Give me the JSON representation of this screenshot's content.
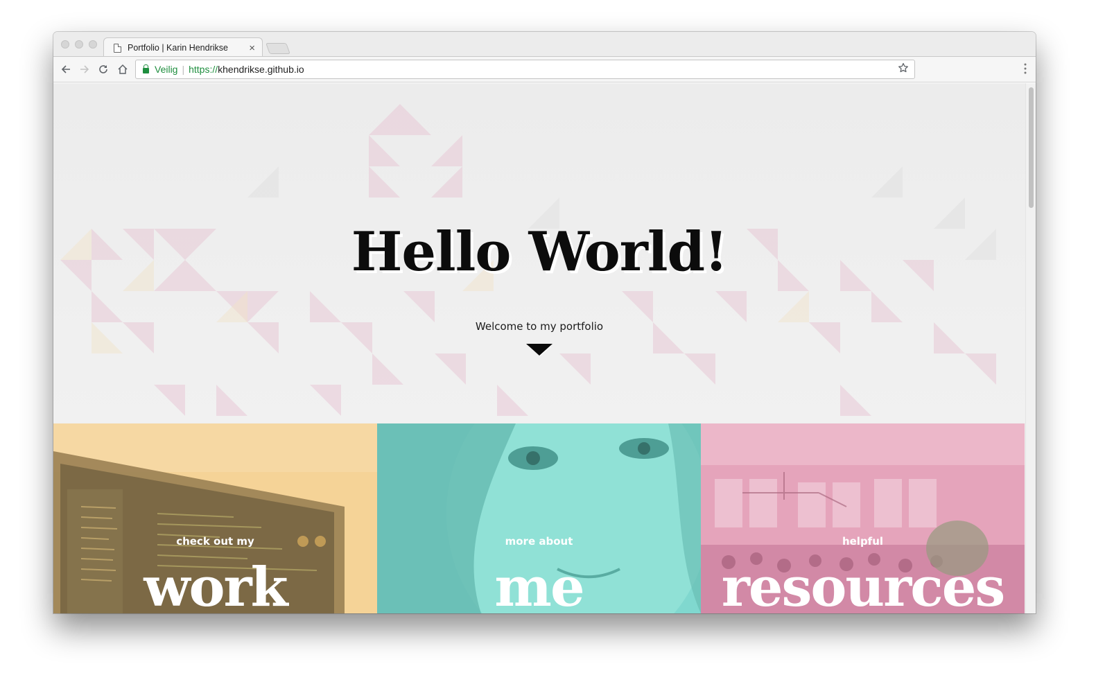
{
  "browser": {
    "tab_title": "Portfolio | Karin Hendrikse",
    "tab_close": "×",
    "secure_label": "Veilig",
    "url_scheme": "https://",
    "url_host": "khendrikse.github.io",
    "icons": {
      "back": "arrow-left-icon",
      "forward": "arrow-right-icon",
      "reload": "reload-icon",
      "home": "home-icon",
      "bookmark": "star-icon",
      "menu": "more-vert-icon",
      "lock": "lock-icon",
      "page": "page-icon"
    }
  },
  "hero": {
    "title": "Hello World!",
    "subtitle": "Welcome to my portfolio"
  },
  "tiles": [
    {
      "label": "check out my",
      "word": "work",
      "tint": "#f4c882"
    },
    {
      "label": "more about",
      "word": "me",
      "tint": "#7cd6cc"
    },
    {
      "label": "helpful",
      "word": "resources",
      "tint": "#e39ab6"
    }
  ]
}
